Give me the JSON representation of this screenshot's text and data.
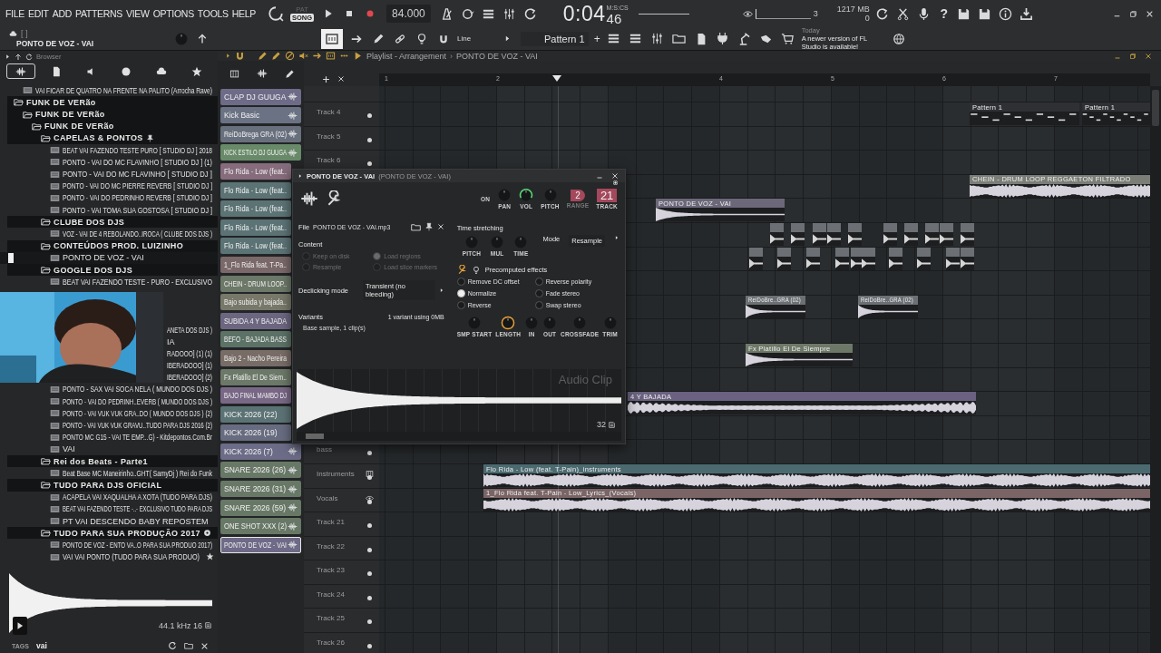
{
  "menu": [
    "FILE",
    "EDIT",
    "ADD",
    "PATTERNS",
    "VIEW",
    "OPTIONS",
    "TOOLS",
    "HELP"
  ],
  "transport": {
    "mode": [
      {
        "label": "PAT",
        "selected": false
      },
      {
        "label": "SONG",
        "selected": true
      }
    ],
    "tempo": "84.000",
    "time": "0:04",
    "time_cs": "46",
    "time_unit": "M:S:CS",
    "cpu": "3",
    "memory": "1217 MB",
    "polyphony": "0",
    "help": "?"
  },
  "hint": {
    "bracket": "[  ]",
    "title": "PONTO DE VOZ - VAI"
  },
  "toolbar": {
    "snap": "Line",
    "pattern": "Pattern 1",
    "add": "+",
    "news_date": "Today",
    "news": "A newer version of FL Studio is available!"
  },
  "browser": {
    "title": "Browser",
    "tabs": [
      {
        "selected": true
      },
      {
        "selected": false
      },
      {
        "selected": false
      },
      {
        "selected": false
      },
      {
        "selected": false
      },
      {
        "selected": false
      }
    ],
    "tree": [
      {
        "kind": "file",
        "name": "VAI FICAR DE QUATRO NA FRENTE NA PALITO (Arrocha Rave)",
        "selected": false
      },
      {
        "kind": "folder",
        "name": "FUNK DE VERão",
        "expanded": true,
        "selected": false,
        "children": [
          {
            "kind": "folder",
            "name": "FUNK DE VERão",
            "expanded": true,
            "selected": false,
            "children": [
              {
                "kind": "folder",
                "name": "FUNK DE VERão",
                "expanded": true,
                "selected": false,
                "children": [
                  {
                    "kind": "folder_pin",
                    "name": "CAPELAS & PONTOS",
                    "expanded": true,
                    "selected": false,
                    "children": [
                      {
                        "kind": "file",
                        "name": "BEAT VAI FAZENDO TESTE  PURO [ STUDIO DJ ]  2018",
                        "selected": false
                      },
                      {
                        "kind": "file",
                        "name": "PONTO - VAI DO MC FLAVINHO [ STUDIO DJ ] (1)",
                        "selected": false
                      },
                      {
                        "kind": "file",
                        "name": "PONTO - VAI DO MC FLAVINHO [ STUDIO DJ ]",
                        "selected": false
                      },
                      {
                        "kind": "file",
                        "name": "PONTO - VAI DO MC PIERRE  REVERB [ STUDIO DJ ]",
                        "selected": false
                      },
                      {
                        "kind": "file",
                        "name": "PONTO - VAI DO PEDRINHO  REVERB [ STUDIO DJ ]",
                        "selected": false
                      },
                      {
                        "kind": "file",
                        "name": "PONTO - VAI TOMA SUA GOSTOSA [ STUDIO DJ ]",
                        "selected": false
                      }
                    ]
                  },
                  {
                    "kind": "folder",
                    "name": "CLUBE DOS DJS",
                    "expanded": true,
                    "selected": false,
                    "children": [
                      {
                        "kind": "file",
                        "name": "VOZ - VAI DE 4 REBOLANDO..IROCA ( CLUBE DOS DJS )",
                        "selected": false
                      }
                    ]
                  },
                  {
                    "kind": "folder",
                    "name": "CONTEÚDOS PROD. LUIZINHO",
                    "expanded": true,
                    "selected": false,
                    "children": [
                      {
                        "kind": "file",
                        "name": "PONTO DE VOZ - VAI",
                        "selected": true
                      }
                    ]
                  },
                  {
                    "kind": "folder",
                    "name": "GOOGLE DOS DJS",
                    "expanded": true,
                    "selected": false,
                    "children": [
                      {
                        "kind": "file",
                        "name": "BEAT  VAI FAZENDO TESTE - PURO - EXCLUSIVO",
                        "selected": false
                      }
                    ]
                  },
                  {
                    "kind": "folder",
                    "children": [
                      {
                        "kind": "file_cut",
                        "name": "ANETA DOS DJS )",
                        "selected": false
                      },
                      {
                        "kind": "file_cut",
                        "name": "IA",
                        "selected": false
                      },
                      {
                        "kind": "file_cut",
                        "name": "RADOOO] (1) (1)",
                        "selected": false
                      },
                      {
                        "kind": "file_cut",
                        "name": "IBERADOOO] (1)",
                        "selected": false
                      },
                      {
                        "kind": "file_cut",
                        "name": "IBERADOOO] (2)",
                        "selected": false
                      },
                      {
                        "kind": "file",
                        "name": "PONTO - SAX VAI  SOCA NELA  ( MUNDO DOS DJS )",
                        "selected": false
                      },
                      {
                        "kind": "file",
                        "name": "PONTO - VAI DO PEDRINH..EVERB ( MUNDO DOS DJS )",
                        "selected": false
                      },
                      {
                        "kind": "file",
                        "name": "PONTO - VAI VUK VUK GRA..DO ( MUNDO DOS DJS ) (2)",
                        "selected": false
                      },
                      {
                        "kind": "file",
                        "name": "PONTO - VAI VUK VUK GRAVU..TUDO PARA DJS 2016 (2)",
                        "selected": false
                      },
                      {
                        "kind": "file",
                        "name": "PONTO MC G15 - VAI TE EMP...G) - Kitdepontos.Com.Br",
                        "selected": false
                      },
                      {
                        "kind": "file",
                        "name": "VAI",
                        "selected": false
                      }
                    ]
                  },
                  {
                    "kind": "folder",
                    "name": "Rei dos Beats - Parte1",
                    "expanded": true,
                    "selected": false,
                    "children": [
                      {
                        "kind": "file",
                        "name": "Beat Base MC Maneirinho..GHT( SamyDj ) Rei do Funk",
                        "selected": false
                      }
                    ]
                  },
                  {
                    "kind": "folder",
                    "name": "TUDO PARA DJS  OFICIAL",
                    "expanded": true,
                    "selected": false,
                    "children": [
                      {
                        "kind": "file",
                        "name": "ACAPELA VAI XAQUALHA A XOTA (TUDO PARA DJS)",
                        "selected": false
                      },
                      {
                        "kind": "file",
                        "name": "BEAT VAI FAZENDO TESTE -..- EXCLUSIVO TUDO PARA DJS",
                        "selected": false
                      },
                      {
                        "kind": "file",
                        "name": "PT VAI DESCENDO BABY REPOSTEM",
                        "selected": false
                      }
                    ]
                  },
                  {
                    "kind": "folder_disc",
                    "name": "TUDO PARA SUA PRODUÇÃO 2017",
                    "expanded": true,
                    "selected": false,
                    "children": [
                      {
                        "kind": "file",
                        "name": "PONTO DE VOZ - ENTO VA..O PARA SUA PRODUO 2017)",
                        "selected": false
                      },
                      {
                        "kind": "file",
                        "name": "VAI VAI PONTO  (TUDO PARA SUA PRODUO)",
                        "selected": false,
                        "starred": true
                      }
                    ]
                  }
                ]
              }
            ]
          }
        ]
      }
    ],
    "preview": {
      "info": "44.1 kHz 16",
      "tags_label": "TAGS",
      "tags": "vai"
    }
  },
  "channels": [
    {
      "name": "CLAP DJ GUUGA",
      "color": "#6e6b88",
      "selected": false
    },
    {
      "name": "Kick Basic",
      "color": "#6a7284",
      "selected": false
    },
    {
      "name": "ReiDoBrega GRA (02)",
      "color": "#68707e",
      "selected": false
    },
    {
      "name": "KICK ESTILO DJ GUUGA",
      "color": "#688a68",
      "selected": false
    },
    {
      "name": "Flo Rida - Low (feat..",
      "color": "#866c7c",
      "selected": false
    },
    {
      "name": "Flo Rida - Low (feat..",
      "color": "#5c7375",
      "selected": false
    },
    {
      "name": "Flo Rida - Low (feat..",
      "color": "#5c7375",
      "selected": false
    },
    {
      "name": "Flo Rida - Low (feat..",
      "color": "#5c7375",
      "selected": false
    },
    {
      "name": "Flo Rida - Low (feat..",
      "color": "#5c7375",
      "selected": false
    },
    {
      "name": "1_Flo Rida feat. T-Pa..",
      "color": "#7a686a",
      "selected": false
    },
    {
      "name": "CHEIN - DRUM LOOP..",
      "color": "#6c7868",
      "selected": false
    },
    {
      "name": "Bajo subida y bajada..",
      "color": "#78786a",
      "selected": false
    },
    {
      "name": "SUBIDA 4 Y BAJADA",
      "color": "#6c6680",
      "selected": false
    },
    {
      "name": "BEFO - BAJADA BASS",
      "color": "#5c7266",
      "selected": false
    },
    {
      "name": "Bajo 2 - Nacho Pereira",
      "color": "#786c66",
      "selected": false
    },
    {
      "name": "Fx Platillo El De Siem..",
      "color": "#6c7868",
      "selected": false
    },
    {
      "name": "BAJO FINAL MAMBO DJ",
      "color": "#786886",
      "selected": false
    },
    {
      "name": "KICK 2026 (22)",
      "color": "#5c7375",
      "selected": false
    },
    {
      "name": "KICK 2026 (19)",
      "color": "#686c80",
      "selected": false
    },
    {
      "name": "KICK 2026 (7)",
      "color": "#6c6c88",
      "selected": false
    },
    {
      "name": "SNARE 2026 (26)",
      "color": "#687866",
      "selected": false
    },
    {
      "name": "SNARE 2026 (31)",
      "color": "#687866",
      "selected": false
    },
    {
      "name": "SNARE 2026 (59)",
      "color": "#687866",
      "selected": false
    },
    {
      "name": "ONE SHOT XXX (2)",
      "color": "#687866",
      "selected": false
    },
    {
      "name": "PONTO DE VOZ - VAI",
      "color": "#6e6a88",
      "selected": true
    }
  ],
  "playlist": {
    "title": "Playlist - Arrangement",
    "separator": "›",
    "pattern": "PONTO DE VOZ - VAI",
    "ruler": [
      "1",
      "2",
      "4",
      "5",
      "6",
      "7"
    ],
    "tracks": [
      {
        "name": "Track 4",
        "kind": "plain"
      },
      {
        "name": "Track 5",
        "kind": "plain"
      },
      {
        "name": "Track 6",
        "kind": "plain"
      },
      {
        "name": "bass",
        "kind": "plain"
      },
      {
        "name": "Instruments",
        "kind": "piano"
      },
      {
        "name": "Vocals",
        "kind": "eye"
      },
      {
        "name": "Track 21",
        "kind": "plain"
      },
      {
        "name": "Track 22",
        "kind": "plain"
      },
      {
        "name": "Track 23",
        "kind": "plain"
      },
      {
        "name": "Track 24",
        "kind": "plain"
      },
      {
        "name": "Track 25",
        "kind": "plain"
      },
      {
        "name": "Track 26",
        "kind": "plain"
      }
    ],
    "clips": [
      {
        "name": "Pattern 1",
        "kind": "pattern",
        "color": "#2e3033"
      },
      {
        "name": "Pattern 1",
        "kind": "pattern",
        "color": "#2e3033"
      },
      {
        "name": "CHEIN - DRUM LOOP REGGAETON FILTRADO",
        "kind": "audio",
        "color": "#7b7e77"
      },
      {
        "name": "PONTO DE VOZ - VAI",
        "kind": "audio",
        "color": "#6c687a"
      },
      {
        "name": "ReiDoBre..GRA (02)",
        "kind": "audio",
        "color": "#6c7074"
      },
      {
        "name": "ReiDoBre..GRA (02)",
        "kind": "audio",
        "color": "#6c7074"
      },
      {
        "name": "Fx Platillo El De Siempre",
        "kind": "audio",
        "color": "#6e7868"
      },
      {
        "name": "4 Y BAJADA",
        "kind": "audio",
        "color": "#6a6280"
      },
      {
        "name": "Flo Rida - Low (feat. T-Pain)_instruments",
        "kind": "audio",
        "color": "#4b6a70"
      },
      {
        "name": "1_Flo Rida feat. T-Pain - Low_Lyrics_(Vocals)",
        "kind": "audio",
        "color": "#7a6466"
      }
    ]
  },
  "sampler": {
    "title": "PONTO DE VOZ - VAI",
    "subtitle": "(PONTO DE VOZ - VAI)",
    "top_knobs": [
      {
        "label": "ON",
        "kind": "led"
      },
      {
        "label": "PAN",
        "kind": "plain"
      },
      {
        "label": "VOL",
        "kind": "green"
      },
      {
        "label": "PITCH",
        "kind": "plain"
      }
    ],
    "range_label": "RANGE",
    "range": "2",
    "track_label": "TRACK",
    "track": "21",
    "file_label": "File",
    "file": "PONTO DE VOZ - VAI.mp3",
    "content_label": "Content",
    "content": [
      {
        "label": "Keep on disk",
        "checked": false,
        "disabled": true
      },
      {
        "label": "Load regions",
        "checked": true,
        "disabled": true
      },
      {
        "label": "Resample",
        "checked": false,
        "disabled": true
      },
      {
        "label": "Load slice markers",
        "checked": false,
        "disabled": true
      }
    ],
    "declick_label": "Declicking mode",
    "declick": "Transient (no bleeding)",
    "variants_label": "Variants",
    "variants_info": "1 variant using 0MB",
    "variant": "Base sample, 1 clip(s)",
    "stretch_label": "Time stretching",
    "stretch_knobs": [
      "PITCH",
      "MUL",
      "TIME"
    ],
    "mode_label": "Mode",
    "mode": "Resample",
    "effects_label": "Precomputed effects",
    "effects": [
      {
        "label": "Remove DC offset",
        "checked": false
      },
      {
        "label": "Reverse polarity",
        "checked": false
      },
      {
        "label": "Normalize",
        "checked": true
      },
      {
        "label": "Fade stereo",
        "checked": false
      },
      {
        "label": "Reverse",
        "checked": false
      },
      {
        "label": "Swap stereo",
        "checked": false
      }
    ],
    "bottom_knobs": [
      {
        "label": "SMP START",
        "kind": "plain"
      },
      {
        "label": "LENGTH",
        "kind": "orange"
      },
      {
        "label": "IN",
        "kind": "plain"
      },
      {
        "label": "OUT",
        "kind": "plain"
      },
      {
        "label": "CROSSFADE",
        "kind": "plain"
      },
      {
        "label": "TRIM",
        "kind": "plain"
      }
    ],
    "wave_label": "Audio Clip",
    "zoom": "32"
  }
}
